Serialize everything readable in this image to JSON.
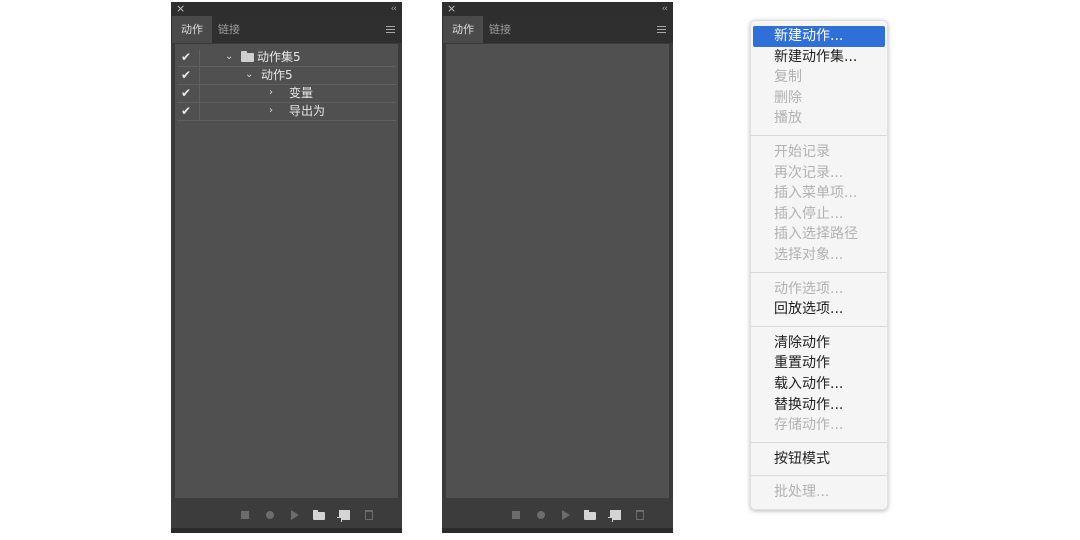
{
  "panels": {
    "left": {
      "tabs": [
        "动作",
        "链接"
      ],
      "rows": [
        {
          "check": "✔",
          "toggle": "⌄",
          "label": "动作集5",
          "kind": "set"
        },
        {
          "check": "✔",
          "toggle": "⌄",
          "label": "动作5",
          "kind": "action"
        },
        {
          "check": "✔",
          "toggle": "›",
          "label": "变量",
          "kind": "step"
        },
        {
          "check": "✔",
          "toggle": "›",
          "label": "导出为",
          "kind": "step"
        }
      ]
    },
    "right": {
      "tabs": [
        "动作",
        "链接"
      ]
    }
  },
  "icons": {
    "close": "×",
    "collapse": "‹‹"
  },
  "colors": {
    "panel_bg": "#505050",
    "menu_highlight": "#2f6fd8"
  },
  "menu": {
    "groups": [
      [
        {
          "label": "新建动作...",
          "enabled": true,
          "highlighted": true
        },
        {
          "label": "新建动作集...",
          "enabled": true
        },
        {
          "label": "复制",
          "enabled": false
        },
        {
          "label": "删除",
          "enabled": false
        },
        {
          "label": "播放",
          "enabled": false
        }
      ],
      [
        {
          "label": "开始记录",
          "enabled": false
        },
        {
          "label": "再次记录...",
          "enabled": false
        },
        {
          "label": "插入菜单项...",
          "enabled": false
        },
        {
          "label": "插入停止...",
          "enabled": false
        },
        {
          "label": "插入选择路径",
          "enabled": false
        },
        {
          "label": "选择对象...",
          "enabled": false
        }
      ],
      [
        {
          "label": "动作选项...",
          "enabled": false
        },
        {
          "label": "回放选项...",
          "enabled": true
        }
      ],
      [
        {
          "label": "清除动作",
          "enabled": true
        },
        {
          "label": "重置动作",
          "enabled": true
        },
        {
          "label": "载入动作...",
          "enabled": true
        },
        {
          "label": "替换动作...",
          "enabled": true
        },
        {
          "label": "存储动作...",
          "enabled": false
        }
      ],
      [
        {
          "label": "按钮模式",
          "enabled": true
        }
      ],
      [
        {
          "label": "批处理...",
          "enabled": false
        }
      ]
    ]
  }
}
